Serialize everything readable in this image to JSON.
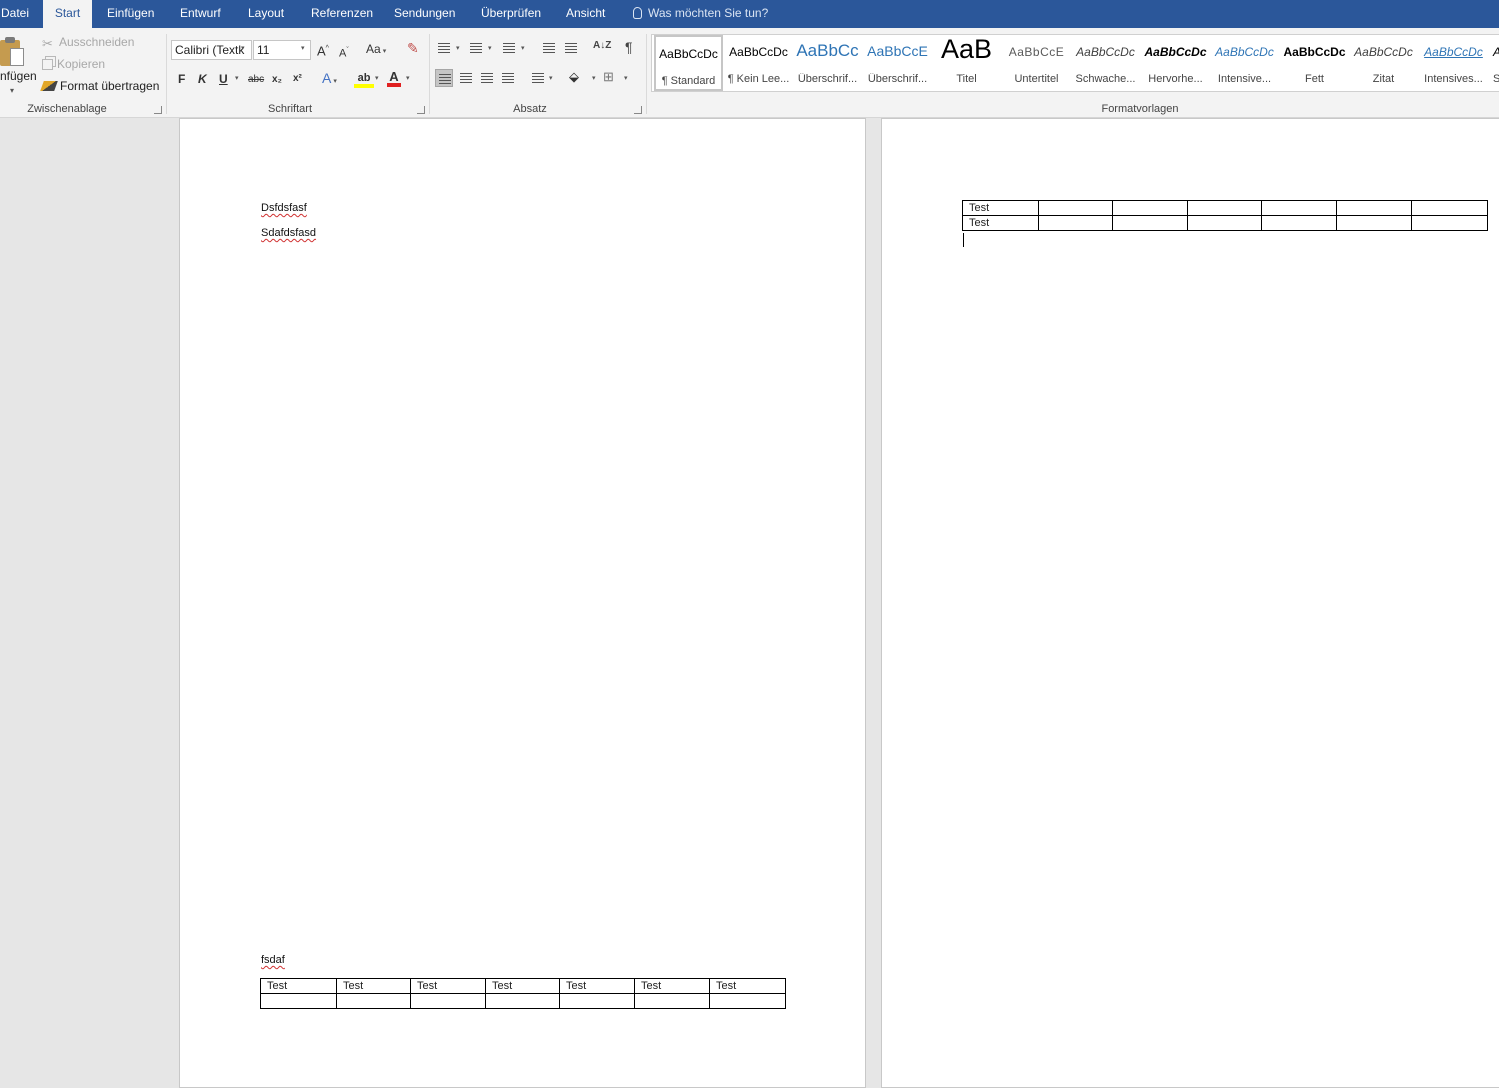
{
  "tabs": [
    "Datei",
    "Start",
    "Einfügen",
    "Entwurf",
    "Layout",
    "Referenzen",
    "Sendungen",
    "Überprüfen",
    "Ansicht"
  ],
  "active_tab": "Start",
  "tell_me": "Was möchten Sie tun?",
  "clipboard": {
    "paste_label": "nfügen",
    "cut_label": "Ausschneiden",
    "copy_label": "Kopieren",
    "format_painter_label": "Format übertragen",
    "group_label": "Zwischenablage"
  },
  "font": {
    "font_name": "Calibri (Textk",
    "font_size": "11",
    "grow_label": "A",
    "shrink_label": "A",
    "case_label": "Aa",
    "bold_label": "F",
    "italic_label": "K",
    "underline_label": "U",
    "strike_label": "abc",
    "subscript_label": "x₂",
    "superscript_label": "x²",
    "effects_label": "A",
    "highlight_label": "ab",
    "font_color_label": "A",
    "highlight_color": "#ffff00",
    "font_color": "#e02020",
    "group_label": "Schriftart"
  },
  "paragraph": {
    "sort_label": "A↓Z",
    "pilcrow": "¶",
    "group_label": "Absatz"
  },
  "styles": {
    "items": [
      {
        "preview": "AaBbCcDc",
        "name": "¶ Standard"
      },
      {
        "preview": "AaBbCcDc",
        "name": "¶ Kein Lee..."
      },
      {
        "preview": "AaBbCc",
        "name": "Überschrif..."
      },
      {
        "preview": "AaBbCcE",
        "name": "Überschrif..."
      },
      {
        "preview": "AaB",
        "name": "Titel"
      },
      {
        "preview": "AaBbCcE",
        "name": "Untertitel"
      },
      {
        "preview": "AaBbCcDc",
        "name": "Schwache..."
      },
      {
        "preview": "AaBbCcDc",
        "name": "Hervorhe..."
      },
      {
        "preview": "AaBbCcDc",
        "name": "Intensive..."
      },
      {
        "preview": "AaBbCcDc",
        "name": "Fett"
      },
      {
        "preview": "AaBbCcDc",
        "name": "Zitat"
      },
      {
        "preview": "AaBbCcDc",
        "name": "Intensives..."
      },
      {
        "preview": "A",
        "name": "S"
      }
    ],
    "group_label": "Formatvorlagen",
    "heading_color": "#2e74b5"
  },
  "document": {
    "page1": {
      "line1": "Dsfdsfasf",
      "line2": "Sdafdsfasd",
      "line3": "fsdaf",
      "table": [
        [
          "Test",
          "Test",
          "Test",
          "Test",
          "Test",
          "Test",
          "Test"
        ],
        [
          "",
          "",
          "",
          "",
          "",
          "",
          ""
        ]
      ]
    },
    "page2": {
      "table": [
        [
          "Test",
          "",
          "",
          "",
          "",
          "",
          ""
        ],
        [
          "Test",
          "",
          "",
          "",
          "",
          "",
          ""
        ]
      ]
    }
  }
}
